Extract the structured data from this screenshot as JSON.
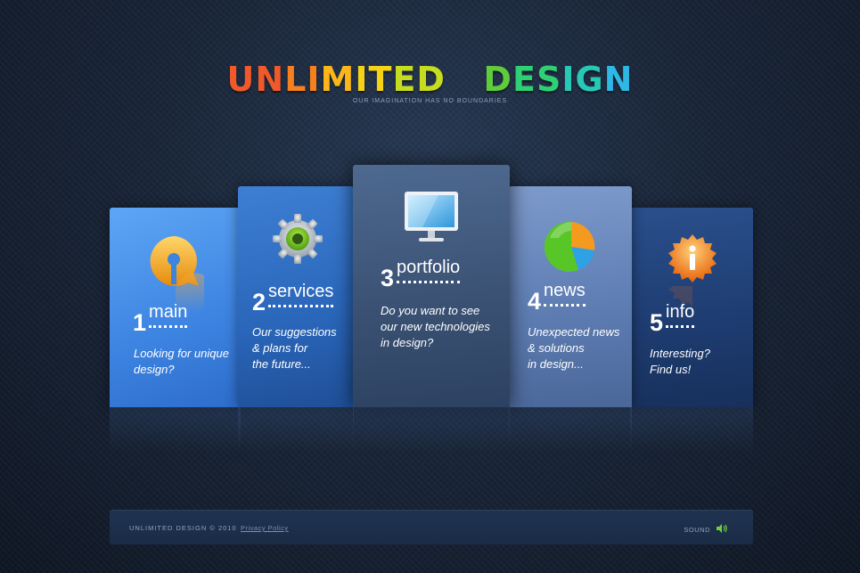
{
  "header": {
    "logo_word1": "UNLIMITED",
    "logo_word2": "DESIGN",
    "logo_colors": [
      "#f05a2a",
      "#f7801e",
      "#fbb61a",
      "#f5d218",
      "#c6dd1f",
      "#5fcc3c",
      "#2fcf73",
      "#27c9b6",
      "#2db8e6"
    ],
    "tagline": "OUR IMAGINATION HAS NO BOUNDARIES"
  },
  "panels": [
    {
      "num": "1",
      "title": "main",
      "desc_lines": [
        "Looking for unique",
        "design?"
      ],
      "icon": "q-logo-icon"
    },
    {
      "num": "2",
      "title": "services",
      "desc_lines": [
        "Our suggestions",
        "& plans for",
        "the future..."
      ],
      "icon": "gear-icon"
    },
    {
      "num": "3",
      "title": "portfolio",
      "desc_lines": [
        "Do you want to see",
        "our new technologies",
        "in design?"
      ],
      "icon": "monitor-icon"
    },
    {
      "num": "4",
      "title": "news",
      "desc_lines": [
        "Unexpected news",
        "& solutions",
        "in design..."
      ],
      "icon": "pie-chart-icon"
    },
    {
      "num": "5",
      "title": "info",
      "desc_lines": [
        "Interesting?",
        "Find us!"
      ],
      "icon": "info-badge-icon"
    }
  ],
  "footer": {
    "copyright": "UNLIMITED DESIGN © 2010",
    "privacy_link": "Privacy Policy",
    "sound_label": "SOUND"
  },
  "colors": {
    "panel1": "#4a92ea",
    "panel2": "#2d6bc0",
    "panel3": "#3e5679",
    "panel4": "#6383b9",
    "panel5": "#1f3f75",
    "sound_icon": "#6fcf3a"
  }
}
